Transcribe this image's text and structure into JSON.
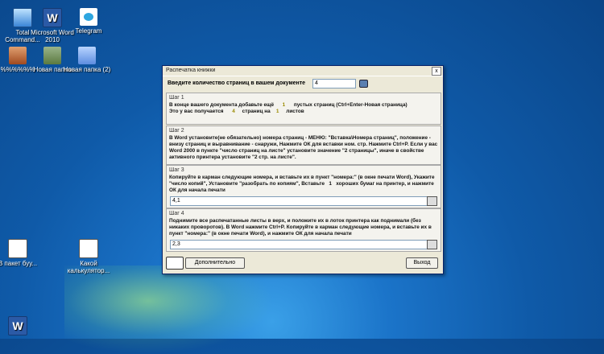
{
  "desktop": {
    "icons_top": [
      {
        "label": "Total Command...",
        "icon": "total-commander-icon"
      },
      {
        "label": "Microsoft Word 2010",
        "icon": "word-icon"
      },
      {
        "label": "Telegram",
        "icon": "telegram-icon"
      }
    ],
    "icons_row2": [
      {
        "label": "%%%%%%",
        "icon": "archive-icon"
      },
      {
        "label": "Новая папка",
        "icon": "folder-icon"
      },
      {
        "label": "Новая папка (2)",
        "icon": "folder-icon"
      }
    ],
    "icons_bottom": [
      {
        "label": "В пакет буу...",
        "icon": "document-icon"
      },
      {
        "label": "Какой калькулятор...",
        "icon": "document-icon"
      },
      {
        "label": "",
        "icon": "word-doc-icon"
      }
    ]
  },
  "dialog": {
    "title": "Распечатка книжки",
    "close": "x",
    "pages_label": "Введите количество страниц в вашем документе",
    "pages_value": "4",
    "step1": {
      "header": "Шаг 1",
      "line1_a": "В конце вашего документа добавьте ещё",
      "line1_num": "1",
      "line1_b": "пустых страниц (Ctrl+Enter-Новая страница)",
      "line2_a": "Это у вас получается",
      "line2_num1": "4",
      "line2_b": "страниц на",
      "line2_num2": "1",
      "line2_c": "листов"
    },
    "step2": {
      "header": "Шаг 2",
      "text": "В Word установите(не обязательно) номера страниц - МЕНЮ: \"Вставка\\Номера страниц\", положение - внизу страниц и выравнивание - снаружи, Нажмите ОК для вставки ном. стр. Нажмите Ctrl+P. Если у вас Word 2000 в пункте \"число страниц на листе\" установите значение \"2 страницы\", иначе в свойстве активного принтера установите \"2 стр. на листе\"."
    },
    "step3": {
      "header": "Шаг 3",
      "text": "Копируйте в карман следующие номера, и вставьте их в пункт \"номера:\" (в окне печати Word), Укажите \"число копий\", Установите \"разобрать по копиям\", Вставьте",
      "num": "1",
      "text2": "хороших бумаг на принтер, и нажмите ОК для начала печати",
      "value": "4,1"
    },
    "step4": {
      "header": "Шаг 4",
      "text": "Поднимите все распечатанные листы в верх, и положите их в лоток принтера как поднимали (без никаких проворотов). В Word нажмите Ctrl+P. Копируйте в карман следующие номера, и вставьте их в пункт \"номера:\" (в окне печати Word), и нажмите ОК для начала печати",
      "value": "2,3"
    },
    "more_button": "Дополнительно",
    "exit_button": "Выход"
  }
}
